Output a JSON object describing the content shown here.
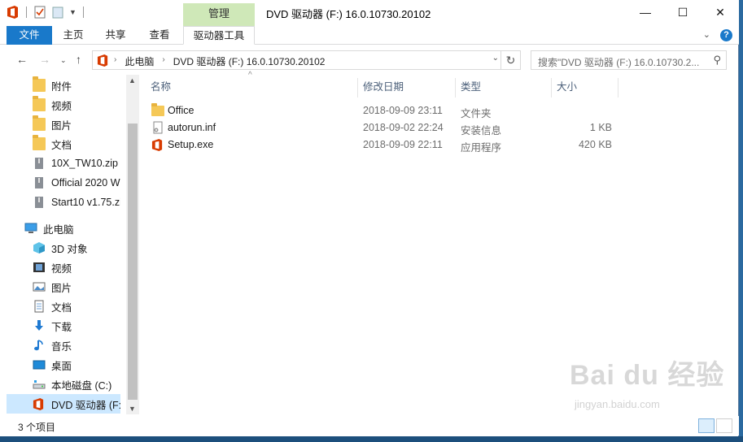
{
  "window": {
    "title": "DVD 驱动器 (F:) 16.0.10730.20102",
    "context_tab_group": "管理"
  },
  "ribbon": {
    "tabs": [
      {
        "label": "文件"
      },
      {
        "label": "主页"
      },
      {
        "label": "共享"
      },
      {
        "label": "查看"
      },
      {
        "label": "驱动器工具"
      }
    ],
    "help_glyph": "?"
  },
  "address": {
    "crumbs": [
      "此电脑",
      "DVD 驱动器 (F:) 16.0.10730.20102"
    ]
  },
  "search": {
    "placeholder": "搜索\"DVD 驱动器 (F:) 16.0.10730.2..."
  },
  "nav": {
    "items": [
      {
        "label": "附件",
        "icon": "folder-icon"
      },
      {
        "label": "视频",
        "icon": "folder-icon"
      },
      {
        "label": "图片",
        "icon": "folder-icon"
      },
      {
        "label": "文档",
        "icon": "folder-icon"
      },
      {
        "label": "10X_TW10.zip",
        "icon": "zip-icon"
      },
      {
        "label": "Official 2020 W",
        "icon": "zip-icon"
      },
      {
        "label": "Start10 v1.75.zi",
        "icon": "zip-icon"
      },
      {
        "label": "此电脑",
        "icon": "pc-icon"
      },
      {
        "label": "3D 对象",
        "icon": "cube-icon"
      },
      {
        "label": "视频",
        "icon": "video-icon"
      },
      {
        "label": "图片",
        "icon": "picture-icon"
      },
      {
        "label": "文档",
        "icon": "document-icon"
      },
      {
        "label": "下载",
        "icon": "download-icon"
      },
      {
        "label": "音乐",
        "icon": "music-icon"
      },
      {
        "label": "桌面",
        "icon": "desktop-icon"
      },
      {
        "label": "本地磁盘 (C:)",
        "icon": "drive-icon"
      },
      {
        "label": "DVD 驱动器 (F:)",
        "icon": "office-icon"
      }
    ]
  },
  "columns": {
    "name": "名称",
    "date": "修改日期",
    "type": "类型",
    "size": "大小"
  },
  "files": [
    {
      "name": "Office",
      "date": "2018-09-09 23:11",
      "type": "文件夹",
      "size": "",
      "icon": "folder-icon"
    },
    {
      "name": "autorun.inf",
      "date": "2018-09-02 22:24",
      "type": "安装信息",
      "size": "1 KB",
      "icon": "settings-file-icon"
    },
    {
      "name": "Setup.exe",
      "date": "2018-09-09 22:11",
      "type": "应用程序",
      "size": "420 KB",
      "icon": "office-icon"
    }
  ],
  "status": {
    "item_count": "3 个项目"
  },
  "watermark": {
    "main": "Bai du 经验",
    "sub": "jingyan.baidu.com"
  },
  "colors": {
    "file_tab": "#1979ca",
    "context_tab": "#cfe8b8",
    "selection": "#cce8ff",
    "office_red": "#d83b01"
  }
}
